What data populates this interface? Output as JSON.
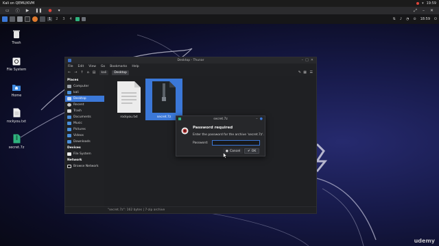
{
  "host": {
    "title": "Kali on QEMU/KVM",
    "clock": "19:59"
  },
  "vm_toolbar": {
    "buttons": [
      "monitor-icon",
      "info-icon",
      "play-icon",
      "pause-icon",
      "stop-icon",
      "dropdown-icon"
    ]
  },
  "panel": {
    "workspaces": [
      "1",
      "2",
      "3",
      "4"
    ],
    "clock": "18:59"
  },
  "desktop": {
    "icons": [
      {
        "label": "Trash",
        "icon": "trash-icon"
      },
      {
        "label": "File System",
        "icon": "filesystem-icon"
      },
      {
        "label": "Home",
        "icon": "home-folder-icon"
      },
      {
        "label": "rockyou.txt",
        "icon": "text-file-icon"
      },
      {
        "label": "secret.7z",
        "icon": "archive-file-icon"
      }
    ]
  },
  "thunar": {
    "title": "Desktop - Thunar",
    "menu": [
      "File",
      "Edit",
      "View",
      "Go",
      "Bookmarks",
      "Help"
    ],
    "breadcrumb": [
      "kali",
      "Desktop"
    ],
    "sidebar": {
      "places_header": "Places",
      "places": [
        {
          "label": "Computer",
          "selected": false
        },
        {
          "label": "kali",
          "selected": false
        },
        {
          "label": "Desktop",
          "selected": true
        },
        {
          "label": "Recent",
          "selected": false
        },
        {
          "label": "Trash",
          "selected": false
        },
        {
          "label": "Documents",
          "selected": false
        },
        {
          "label": "Music",
          "selected": false
        },
        {
          "label": "Pictures",
          "selected": false
        },
        {
          "label": "Videos",
          "selected": false
        },
        {
          "label": "Downloads",
          "selected": false
        }
      ],
      "devices_header": "Devices",
      "devices": [
        {
          "label": "File System"
        }
      ],
      "network_header": "Network",
      "network": [
        {
          "label": "Browse Network"
        }
      ]
    },
    "files": [
      {
        "name": "rockyou.txt",
        "icon": "text-file-icon",
        "selected": false
      },
      {
        "name": "secret.7z",
        "icon": "archive-file-icon",
        "selected": true
      }
    ],
    "status": "\"secret.7z\": 162 bytes | 7-zip archive"
  },
  "dialog": {
    "title": "secret.7z",
    "heading": "Password required",
    "message": "Enter the password for the archive 'secret.7z'.",
    "password_label": "Password:",
    "password_value": "",
    "cancel_label": "Cancel",
    "ok_label": "OK"
  },
  "watermark": "udemy",
  "colors": {
    "accent": "#3b78d8",
    "selection": "#3b78d8",
    "panel_bg": "#161618"
  }
}
